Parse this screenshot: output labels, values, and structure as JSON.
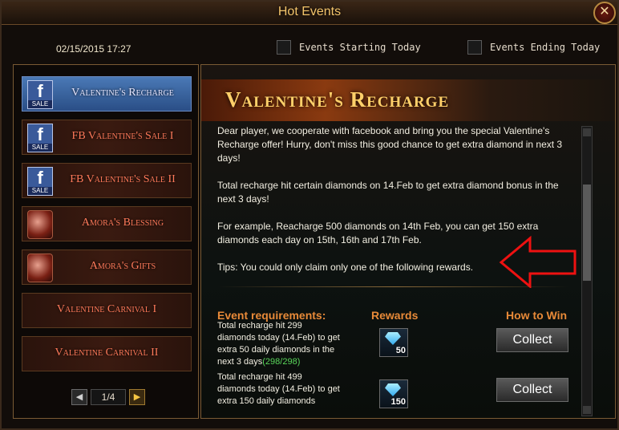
{
  "window": {
    "title": "Hot Events"
  },
  "header": {
    "datetime": "02/15/2015 17:27",
    "filters": [
      {
        "label": "Events Starting Today"
      },
      {
        "label": "Events Ending Today"
      }
    ]
  },
  "sidebar": {
    "items": [
      {
        "label": "Valentine's Recharge",
        "icon": "facebook-sale-icon"
      },
      {
        "label": "FB Valentine's Sale I",
        "icon": "facebook-sale-icon"
      },
      {
        "label": "FB Valentine's Sale II",
        "icon": "facebook-sale-icon"
      },
      {
        "label": "Amora's Blessing",
        "icon": "amora-portrait-icon"
      },
      {
        "label": "Amora's Gifts",
        "icon": "amora-portrait-icon"
      },
      {
        "label": "Valentine Carnival I"
      },
      {
        "label": "Valentine Carnival II"
      }
    ],
    "icon_badge": {
      "f": "f",
      "sale": "SALE"
    },
    "pager": {
      "page": "1/4"
    }
  },
  "main": {
    "banner_title": "Valentine's Recharge",
    "paragraphs": [
      "Dear player, we cooperate with facebook and bring you the special Valentine's Recharge offer! Hurry, don't miss this good chance to get extra diamond in next 3 days!",
      "Total recharge hit certain diamonds on 14.Feb to get extra diamond bonus in the next 3 days!",
      "For example, Reacharge 500 diamonds on 14th Feb, you can get 150 extra diamonds each day on 15th, 16th and 17th Feb.",
      "Tips: You could only claim only one of the following rewards."
    ],
    "columns": {
      "requirements": "Event requirements:",
      "rewards": "Rewards",
      "how": "How to Win"
    },
    "rows": [
      {
        "requirement": "Total recharge hit 299 diamonds today (14.Feb) to get extra 50 daily diamonds in the next 3 days",
        "progress": "(298/298)",
        "reward_qty": "50",
        "action": "Collect"
      },
      {
        "requirement": "Total recharge hit 499 diamonds today (14.Feb) to get extra 150 daily diamonds",
        "progress": "",
        "reward_qty": "150",
        "action": "Collect"
      }
    ]
  },
  "colors": {
    "accent": "#e88a38",
    "title": "#f3c46a",
    "progress": "#5ad65a"
  }
}
